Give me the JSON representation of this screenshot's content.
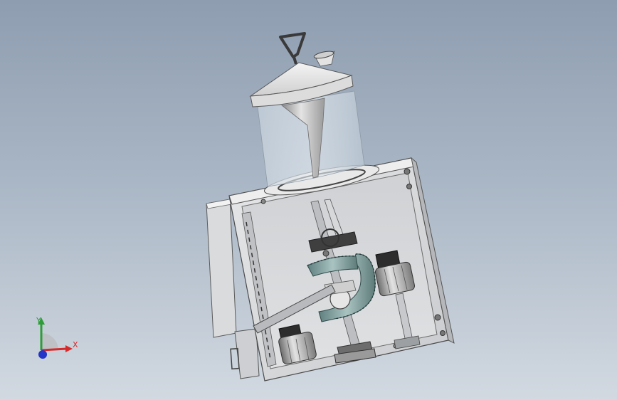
{
  "viewport": {
    "background_top": "#8e9db0",
    "background_bottom": "#d2d9e1"
  },
  "model": {
    "name": "",
    "parts": [
      "hopper-lid",
      "lid-handle",
      "feed-funnel",
      "transparent-hopper",
      "machine-housing",
      "side-panel",
      "bevel-gear-large",
      "bevel-gear-small",
      "motor-right",
      "motor-bottom",
      "support-rod",
      "drive-shaft"
    ]
  },
  "triad": {
    "x_label": "X",
    "y_label": "Y",
    "x_color": "#d62a2a",
    "y_color": "#2f9c3a",
    "z_color": "#2433c8"
  }
}
